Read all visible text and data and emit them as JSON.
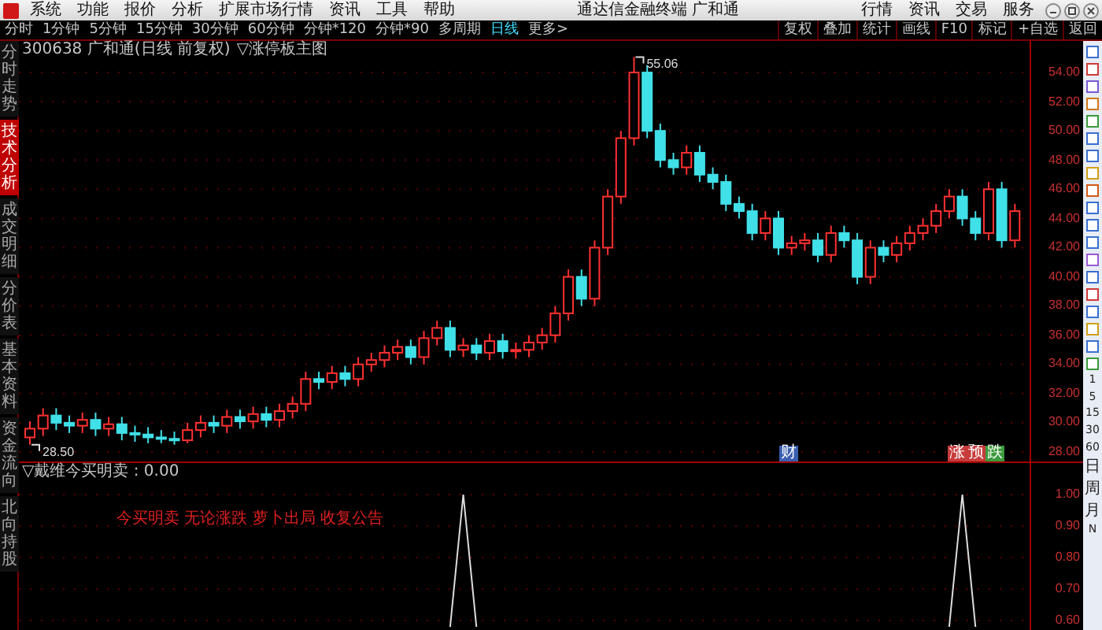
{
  "menu": [
    "系统",
    "功能",
    "报价",
    "分析",
    "扩展市场行情",
    "资讯",
    "工具",
    "帮助"
  ],
  "window_title": "通达信金融终端 广和通",
  "top_right_menu": [
    "行情",
    "资讯",
    "交易",
    "服务"
  ],
  "period_tabs": [
    {
      "label": "分时",
      "selected": false
    },
    {
      "label": "1分钟",
      "selected": false
    },
    {
      "label": "5分钟",
      "selected": false
    },
    {
      "label": "15分钟",
      "selected": false
    },
    {
      "label": "30分钟",
      "selected": false
    },
    {
      "label": "60分钟",
      "selected": false
    },
    {
      "label": "分钟*120",
      "selected": false
    },
    {
      "label": "分钟*90",
      "selected": false
    },
    {
      "label": "多周期",
      "selected": false
    },
    {
      "label": "日线",
      "selected": true
    },
    {
      "label": "更多>",
      "selected": false
    }
  ],
  "tool_buttons": [
    "复权",
    "叠加",
    "统计",
    "画线",
    "F10",
    "标记",
    "+自选",
    "返回"
  ],
  "side_tabs": [
    {
      "label": "分时走势",
      "selected": false
    },
    {
      "label": "技术分析",
      "selected": true
    },
    {
      "label": "成交明细",
      "selected": false
    },
    {
      "label": "分价表",
      "selected": false
    },
    {
      "label": "基本资料",
      "selected": false
    },
    {
      "label": "资金流向",
      "selected": false
    },
    {
      "label": "北向持股",
      "selected": false
    }
  ],
  "main_chart": {
    "stock_title": "300638 广和通(日线 前复权)",
    "formula": "▽涨停板主图",
    "high_label": "55.06",
    "low_label": "28.50",
    "markers": [
      {
        "label": "财",
        "color": "#3a5fb0"
      },
      {
        "label": "涨",
        "color": "#c83c3c"
      },
      {
        "label": "预",
        "color": "#c83c3c"
      },
      {
        "label": "跌",
        "color": "#3c9a3c"
      }
    ],
    "chart_data": {
      "type": "candlestick",
      "ylim": [
        27.35,
        56.16
      ],
      "grid": true,
      "yticks": [
        {
          "value": 54,
          "label": "54.00"
        },
        {
          "value": 52,
          "label": "52.00"
        },
        {
          "value": 50,
          "label": "50.00"
        },
        {
          "value": 48,
          "label": "48.00"
        },
        {
          "value": 46,
          "label": "46.00"
        },
        {
          "value": 44,
          "label": "44.00"
        },
        {
          "value": 42,
          "label": "42.00"
        },
        {
          "value": 40,
          "label": "40.00"
        },
        {
          "value": 38,
          "label": "38.00"
        },
        {
          "value": 36,
          "label": "36.00"
        },
        {
          "value": 34,
          "label": "34.00"
        },
        {
          "value": 32,
          "label": "32.00"
        },
        {
          "value": 30,
          "label": "30.00"
        },
        {
          "value": 28,
          "label": "28.00"
        }
      ],
      "ohlc": [
        [
          29.0,
          30.1,
          28.5,
          29.6
        ],
        [
          29.6,
          31.0,
          29.1,
          30.5
        ],
        [
          30.5,
          31.0,
          29.5,
          30.0
        ],
        [
          30.0,
          30.5,
          29.3,
          29.8
        ],
        [
          29.8,
          30.7,
          29.3,
          30.2
        ],
        [
          30.2,
          30.7,
          29.1,
          29.6
        ],
        [
          29.6,
          30.4,
          29.1,
          29.9
        ],
        [
          29.9,
          30.4,
          28.8,
          29.3
        ],
        [
          29.3,
          29.8,
          28.7,
          29.2
        ],
        [
          29.2,
          29.7,
          28.6,
          29.0
        ],
        [
          29.0,
          29.5,
          28.6,
          28.9
        ],
        [
          28.9,
          29.4,
          28.5,
          28.8
        ],
        [
          28.8,
          30.0,
          28.6,
          29.5
        ],
        [
          29.5,
          30.5,
          29.0,
          30.0
        ],
        [
          30.0,
          30.5,
          29.3,
          29.8
        ],
        [
          29.8,
          30.9,
          29.3,
          30.4
        ],
        [
          30.4,
          30.9,
          29.6,
          30.1
        ],
        [
          30.1,
          31.1,
          29.6,
          30.6
        ],
        [
          30.6,
          31.1,
          29.7,
          30.2
        ],
        [
          30.2,
          31.3,
          29.7,
          30.8
        ],
        [
          30.8,
          31.8,
          30.3,
          31.3
        ],
        [
          31.3,
          33.5,
          30.8,
          33.0
        ],
        [
          33.0,
          33.5,
          32.3,
          32.8
        ],
        [
          32.8,
          33.9,
          32.3,
          33.4
        ],
        [
          33.4,
          33.9,
          32.5,
          33.0
        ],
        [
          33.0,
          34.5,
          32.5,
          34.0
        ],
        [
          34.0,
          34.8,
          33.5,
          34.3
        ],
        [
          34.3,
          35.3,
          33.8,
          34.8
        ],
        [
          34.8,
          35.7,
          34.3,
          35.2
        ],
        [
          35.2,
          35.7,
          34.0,
          34.5
        ],
        [
          34.5,
          36.3,
          34.0,
          35.8
        ],
        [
          35.8,
          37.0,
          35.3,
          36.5
        ],
        [
          36.5,
          37.0,
          34.5,
          35.0
        ],
        [
          35.0,
          35.8,
          34.5,
          35.3
        ],
        [
          35.3,
          35.8,
          34.3,
          34.8
        ],
        [
          34.8,
          36.1,
          34.3,
          35.6
        ],
        [
          35.6,
          36.1,
          34.4,
          34.9
        ],
        [
          34.9,
          35.5,
          34.4,
          35.0
        ],
        [
          35.0,
          36.0,
          34.5,
          35.5
        ],
        [
          35.5,
          36.5,
          35.0,
          36.0
        ],
        [
          36.0,
          38.0,
          35.5,
          37.5
        ],
        [
          37.5,
          40.5,
          37.0,
          40.0
        ],
        [
          40.0,
          40.5,
          38.0,
          38.5
        ],
        [
          38.5,
          42.5,
          38.0,
          42.0
        ],
        [
          42.0,
          46.0,
          41.5,
          45.5
        ],
        [
          45.5,
          50.0,
          45.0,
          49.5
        ],
        [
          49.5,
          55.06,
          49.0,
          54.0
        ],
        [
          54.0,
          54.5,
          49.5,
          50.0
        ],
        [
          50.0,
          50.5,
          47.5,
          48.0
        ],
        [
          48.0,
          48.5,
          47.0,
          47.5
        ],
        [
          47.5,
          49.0,
          47.0,
          48.5
        ],
        [
          48.5,
          49.0,
          46.5,
          47.0
        ],
        [
          47.0,
          47.5,
          46.0,
          46.5
        ],
        [
          46.5,
          47.0,
          44.5,
          45.0
        ],
        [
          45.0,
          45.5,
          44.0,
          44.5
        ],
        [
          44.5,
          45.0,
          42.5,
          43.0
        ],
        [
          43.0,
          44.5,
          42.5,
          44.0
        ],
        [
          44.0,
          44.5,
          41.5,
          42.0
        ],
        [
          42.0,
          42.8,
          41.5,
          42.3
        ],
        [
          42.3,
          43.0,
          41.8,
          42.5
        ],
        [
          42.5,
          43.0,
          41.0,
          41.5
        ],
        [
          41.5,
          43.5,
          41.0,
          43.0
        ],
        [
          43.0,
          43.5,
          42.0,
          42.5
        ],
        [
          42.5,
          43.0,
          39.5,
          40.0
        ],
        [
          40.0,
          42.5,
          39.5,
          42.0
        ],
        [
          42.0,
          42.5,
          41.0,
          41.5
        ],
        [
          41.5,
          42.8,
          41.0,
          42.3
        ],
        [
          42.3,
          43.5,
          41.8,
          43.0
        ],
        [
          43.0,
          44.0,
          42.5,
          43.5
        ],
        [
          43.5,
          45.0,
          43.0,
          44.5
        ],
        [
          44.5,
          46.0,
          44.0,
          45.5
        ],
        [
          45.5,
          46.0,
          43.5,
          44.0
        ],
        [
          44.0,
          44.5,
          42.5,
          43.0
        ],
        [
          43.0,
          46.5,
          42.5,
          46.0
        ],
        [
          46.0,
          46.5,
          42.0,
          42.5
        ],
        [
          42.5,
          45.0,
          42.0,
          44.5
        ]
      ]
    }
  },
  "indicator": {
    "title": "▽戴维今买明卖 : 0.00",
    "note": "今买明卖 无论涨跌 萝卜出局 收复公告",
    "chart_data": {
      "type": "line",
      "ylim": [
        0.57,
        1.1
      ],
      "grid": true,
      "yticks": [
        {
          "value": 1.0,
          "label": "1.00"
        },
        {
          "value": 0.9,
          "label": "0.90"
        },
        {
          "value": 0.8,
          "label": "0.80"
        },
        {
          "value": 0.7,
          "label": "0.70"
        },
        {
          "value": 0.6,
          "label": "0.60"
        }
      ],
      "series": [
        {
          "color": "#dddddd",
          "values": [
            null,
            null,
            null,
            null,
            null,
            null,
            null,
            null,
            null,
            null,
            null,
            null,
            null,
            null,
            null,
            null,
            null,
            null,
            null,
            null,
            null,
            null,
            null,
            null,
            null,
            null,
            null,
            null,
            null,
            null,
            null,
            null,
            0.58,
            1,
            0.58,
            null,
            null,
            null,
            null,
            null,
            null,
            null,
            null,
            null,
            null,
            null,
            null,
            null,
            null,
            null,
            null,
            null,
            null,
            null,
            null,
            null,
            null,
            null,
            null,
            null,
            null,
            null,
            null,
            null,
            null,
            null,
            null,
            null,
            null,
            null,
            0.58,
            1,
            0.58,
            null,
            null,
            null
          ]
        }
      ]
    }
  },
  "side_periods": [
    "1",
    "5",
    "15",
    "30",
    "60",
    "日",
    "周",
    "月",
    "N"
  ]
}
